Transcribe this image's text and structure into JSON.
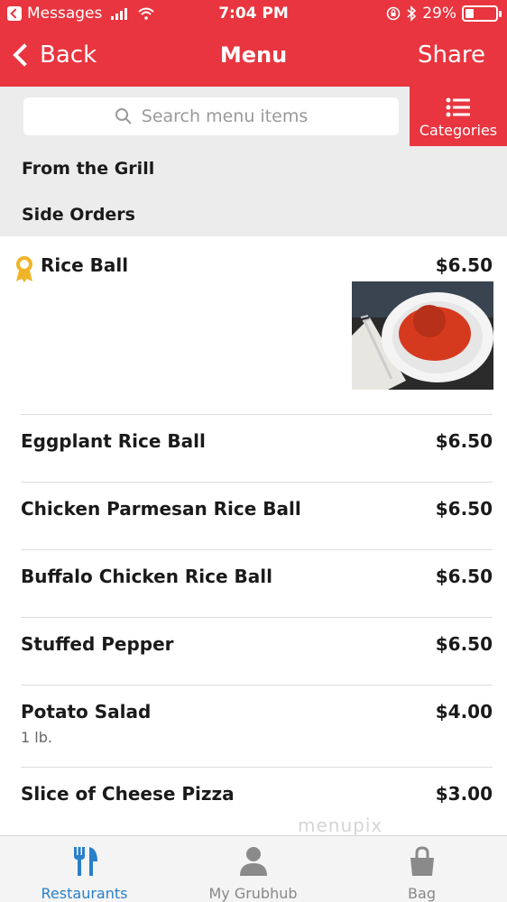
{
  "status_bar": {
    "carrier": "Messages",
    "time": "7:04 PM",
    "battery_percent": "29%",
    "battery_level": 0.29
  },
  "nav": {
    "back_label": "Back",
    "title": "Menu",
    "share_label": "Share"
  },
  "search": {
    "placeholder": "Search menu items",
    "icon": "search-icon"
  },
  "categories_button": {
    "label": "Categories",
    "icon": "list-icon"
  },
  "categories": [
    {
      "label": "From the Grill"
    },
    {
      "label": "Side Orders"
    }
  ],
  "items": [
    {
      "name": "Rice Ball",
      "price": "$6.50",
      "badge": "award-icon",
      "has_photo": true
    },
    {
      "name": "Eggplant Rice Ball",
      "price": "$6.50"
    },
    {
      "name": "Chicken Parmesan Rice Ball",
      "price": "$6.50"
    },
    {
      "name": "Buffalo Chicken Rice Ball",
      "price": "$6.50"
    },
    {
      "name": "Stuffed Pepper",
      "price": "$6.50"
    },
    {
      "name": "Potato Salad",
      "price": "$4.00",
      "description": "1 lb."
    },
    {
      "name": "Slice of Cheese Pizza",
      "price": "$3.00"
    }
  ],
  "watermark": "menupix",
  "tabs": [
    {
      "label": "Restaurants",
      "icon": "fork-knife-icon",
      "active": true
    },
    {
      "label": "My Grubhub",
      "icon": "person-icon",
      "active": false
    },
    {
      "label": "Bag",
      "icon": "bag-icon",
      "active": false
    }
  ],
  "colors": {
    "brand_red": "#e8353f",
    "active_tab": "#2a7fc9",
    "award_gold": "#f0b429"
  }
}
